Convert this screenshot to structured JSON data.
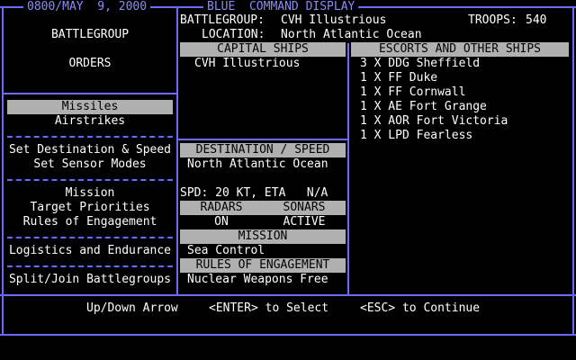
{
  "header": {
    "datetime": "0800/MAY  9, 2000",
    "title": "BLUE  COMMAND DISPLAY"
  },
  "left_panel": {
    "heading_line1": "BATTLEGROUP",
    "heading_line2": "ORDERS",
    "menu": [
      {
        "label": "Missiles",
        "selected": true
      },
      {
        "label": "Airstrikes",
        "selected": false
      },
      {
        "label": "Set Destination & Speed",
        "selected": false
      },
      {
        "label": "Set Sensor Modes",
        "selected": false
      },
      {
        "label": "Mission",
        "selected": false
      },
      {
        "label": "Target Priorities",
        "selected": false
      },
      {
        "label": "Rules of Engagement",
        "selected": false
      },
      {
        "label": "Logistics and Endurance",
        "selected": false
      },
      {
        "label": "Split/Join Battlegroups",
        "selected": false
      }
    ]
  },
  "info": {
    "battlegroup_label": "BATTLEGROUP:",
    "battlegroup_value": "CVH Illustrious",
    "troops_label": "TROOPS:",
    "troops_value": "540",
    "location_label": "LOCATION:",
    "location_value": "North Atlantic Ocean"
  },
  "capital_ships": {
    "header": "CAPITAL SHIPS",
    "items": [
      "CVH Illustrious"
    ]
  },
  "escorts": {
    "header": "ESCORTS AND OTHER SHIPS",
    "items": [
      "3 X DDG Sheffield",
      "1 X FF Duke",
      "1 X FF Cornwall",
      "1 X AE Fort Grange",
      "1 X AOR Fort Victoria",
      "1 X LPD Fearless"
    ]
  },
  "destination": {
    "header": "DESTINATION / SPEED",
    "value": "North Atlantic Ocean",
    "speed": "SPD: 20 KT, ETA   N/A"
  },
  "sensors": {
    "radars_header": "RADARS",
    "sonars_header": "SONARS",
    "radars_value": "ON",
    "sonars_value": "ACTIVE"
  },
  "mission": {
    "header": "MISSION",
    "value": "Sea Control"
  },
  "roe": {
    "header": "RULES OF ENGAGEMENT",
    "value": "Nuclear Weapons Free"
  },
  "footer": {
    "hint_arrows": "Up/Down Arrow",
    "hint_enter": "<ENTER> to Select",
    "hint_esc": "<ESC> to Continue"
  },
  "colors": {
    "frame": "#6b6bff",
    "title": "#8a8aff",
    "highlight": "#b0b0b0"
  }
}
